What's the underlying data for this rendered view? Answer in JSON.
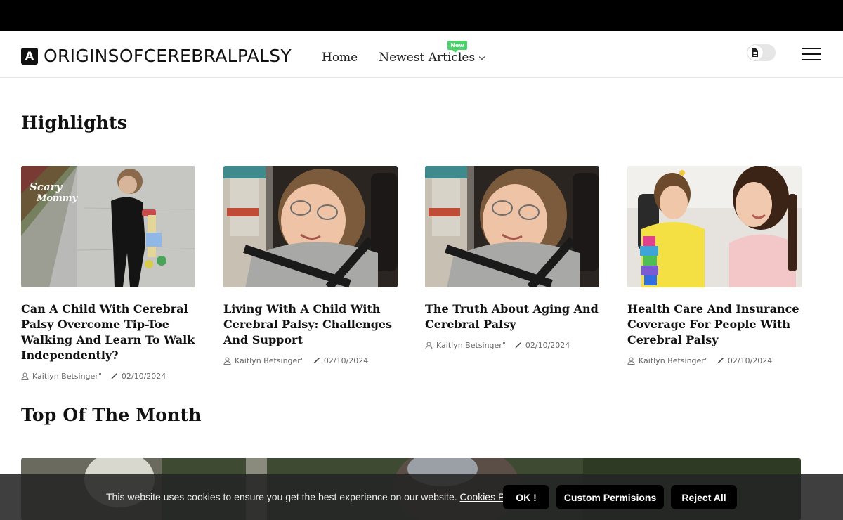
{
  "site": {
    "logo_letter": "A",
    "logo_text": "ORIGINSOFCEREBRALPALSY",
    "logo_icon": "logo-a-icon"
  },
  "nav": {
    "home": "Home",
    "newest": "Newest Articles",
    "new_badge": "New"
  },
  "header_icons": {
    "theme_toggle_icon": "document-icon",
    "menu_icon": "hamburger-menu-icon"
  },
  "sections": {
    "highlights": "Highlights",
    "top_of_month": "Top Of The Month"
  },
  "articles": [
    {
      "title": "Can A Child With Cerebral Palsy Overcome Tip-Toe Walking And Learn To Walk Independently?",
      "author": "Kaitlyn Betsinger\"",
      "date": "02/10/2024",
      "image_watermark": "Scary Mommy"
    },
    {
      "title": "Living With A Child With Cerebral Palsy: Challenges And Support",
      "author": "Kaitlyn Betsinger\"",
      "date": "02/10/2024"
    },
    {
      "title": "The Truth About Aging And Cerebral Palsy",
      "author": "Kaitlyn Betsinger\"",
      "date": "02/10/2024"
    },
    {
      "title": "Health Care And Insurance Coverage For People With Cerebral Palsy",
      "author": "Kaitlyn Betsinger\"",
      "date": "02/10/2024"
    }
  ],
  "cookie": {
    "text": "This website uses cookies to ensure you get the best experience on our website.",
    "policy_link": "Cookies Policy",
    "period": ".",
    "ok": "OK !",
    "custom": "Custom Permisions",
    "reject": "Reject All"
  },
  "colors": {
    "topbar": "#000000",
    "new_badge": "#4cd16b",
    "cookie_bar": "#242424"
  }
}
